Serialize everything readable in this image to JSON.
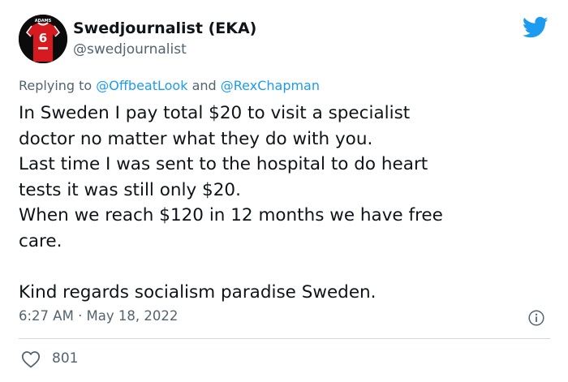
{
  "author": {
    "name": "Swedjournalist (EKA)",
    "handle": "@swedjournalist",
    "avatar_text": "ADAMS",
    "avatar_number": "6"
  },
  "reply": {
    "prefix": "Replying to",
    "mention1": "@OffbeatLook",
    "conjunction": "and",
    "mention2": "@RexChapman"
  },
  "tweet": {
    "lines": [
      "In Sweden I pay total $20 to visit a specialist",
      "doctor no matter what they do with you.",
      "Last time I was sent to the hospital to do heart",
      "tests it was still only $20.",
      "When we reach $120 in 12 months we have free",
      "care.",
      "",
      "Kind regards socialism paradise Sweden."
    ]
  },
  "meta": {
    "timestamp": "6:27 AM · May 18, 2022"
  },
  "stats": {
    "likes": "801"
  },
  "icons": {
    "brand": "twitter-bird-icon",
    "info": "info-icon",
    "like": "heart-icon"
  },
  "colors": {
    "brand": "#1d9bf0",
    "text": "#0f1419",
    "secondary": "#536471"
  }
}
